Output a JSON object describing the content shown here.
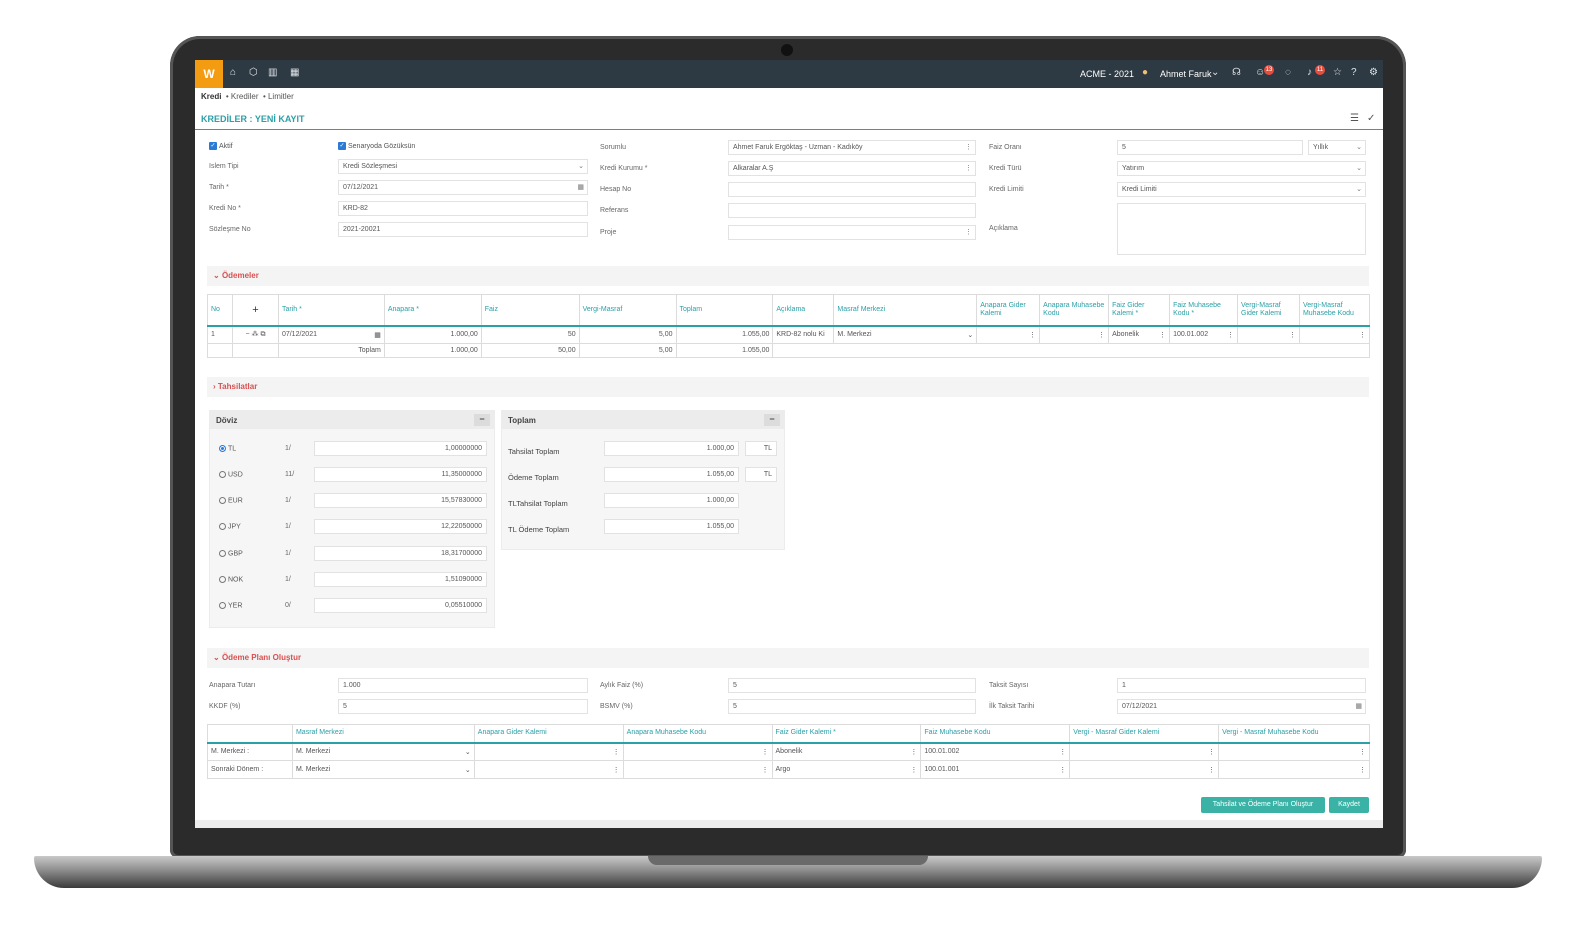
{
  "topbar": {
    "logo": "W",
    "company": "ACME - 2021",
    "user": "Ahmet Faruk",
    "badge_messages": "13",
    "badge_notifications": "11"
  },
  "breadcrumb": {
    "root": "Kredi",
    "items": [
      "• Krediler",
      "• Limitler"
    ]
  },
  "page_title": "KREDİLER : YENİ KAYIT",
  "form": {
    "aktif": "Aktif",
    "senaryo": "Senaryoda Gözüksün",
    "islem_tipi": {
      "label": "Islem Tipi",
      "value": "Kredi Sözleşmesi"
    },
    "tarih": {
      "label": "Tarih *",
      "value": "07/12/2021"
    },
    "kredi_no": {
      "label": "Kredi No *",
      "value": "KRD-82"
    },
    "sozlesme_no": {
      "label": "Sözleşme No",
      "value": "2021-20021"
    },
    "sorumlu": {
      "label": "Sorumlu",
      "value": "Ahmet Faruk Ergöktaş - Uzman - Kadıköy"
    },
    "kredi_kurumu": {
      "label": "Kredi Kurumu *",
      "value": "Alkaralar A.Ş"
    },
    "hesap_no": {
      "label": "Hesap No",
      "value": ""
    },
    "referans": {
      "label": "Referans",
      "value": ""
    },
    "proje": {
      "label": "Proje",
      "value": ""
    },
    "faiz_orani": {
      "label": "Faiz Oranı",
      "value": "5",
      "period": "Yıllık"
    },
    "kredi_turu": {
      "label": "Kredi Türü",
      "value": "Yatırım"
    },
    "kredi_limiti": {
      "label": "Kredi Limiti",
      "value": "Kredi Limiti"
    },
    "aciklama": {
      "label": "Açıklama",
      "value": ""
    }
  },
  "odemeler": {
    "title": "Ödemeler",
    "headers": [
      "No",
      "",
      "Tarih *",
      "Anapara *",
      "Faiz",
      "Vergi-Masraf",
      "Toplam",
      "Açıklama",
      "Masraf Merkezi",
      "Anapara Gider Kalemi",
      "Anapara Muhasebe Kodu",
      "Faiz Gider Kalemi *",
      "Faiz Muhasebe Kodu *",
      "Vergi-Masraf Gider Kalemi",
      "Vergi-Masraf Muhasebe Kodu"
    ],
    "row": {
      "no": "1",
      "tarih": "07/12/2021",
      "anapara": "1.000,00",
      "faiz": "50",
      "vergi": "5,00",
      "toplam": "1.055,00",
      "aciklama": "KRD-82 nolu Ki",
      "masraf_merkezi": "M. Merkezi",
      "anapara_gider": "",
      "anapara_muh": "",
      "faiz_gider": "Abonelik",
      "faiz_muh": "100.01.002",
      "vergi_gider": "",
      "vergi_muh": ""
    },
    "total": {
      "label": "Toplam",
      "anapara": "1.000,00",
      "faiz": "50,00",
      "vergi": "5,00",
      "toplam": "1.055,00"
    }
  },
  "tahsilatlar_title": "Tahsilatlar",
  "doviz": {
    "title": "Döviz",
    "rows": [
      {
        "code": "TL",
        "unit": "1/",
        "rate": "1,00000000",
        "selected": true
      },
      {
        "code": "USD",
        "unit": "11/",
        "rate": "11,35000000"
      },
      {
        "code": "EUR",
        "unit": "1/",
        "rate": "15,57830000"
      },
      {
        "code": "JPY",
        "unit": "1/",
        "rate": "12,22050000"
      },
      {
        "code": "GBP",
        "unit": "1/",
        "rate": "18,31700000"
      },
      {
        "code": "NOK",
        "unit": "1/",
        "rate": "1,51090000"
      },
      {
        "code": "YER",
        "unit": "0/",
        "rate": "0,05510000"
      }
    ]
  },
  "toplam": {
    "title": "Toplam",
    "rows": [
      {
        "label": "Tahsilat Toplam",
        "value": "1.000,00",
        "cur": "TL"
      },
      {
        "label": "Ödeme Toplam",
        "value": "1.055,00",
        "cur": "TL"
      },
      {
        "label": "TLTahsilat Toplam",
        "value": "1.000,00",
        "cur": ""
      },
      {
        "label": "TL Ödeme Toplam",
        "value": "1.055,00",
        "cur": ""
      }
    ]
  },
  "plan": {
    "title": "Ödeme Planı Oluştur",
    "anapara_tutari": {
      "label": "Anapara Tutarı",
      "value": "1.000"
    },
    "kkdf": {
      "label": "KKDF (%)",
      "value": "5"
    },
    "aylik_faiz": {
      "label": "Aylık Faiz (%)",
      "value": "5"
    },
    "bsmv": {
      "label": "BSMV (%)",
      "value": "5"
    },
    "taksit_sayisi": {
      "label": "Taksit Sayısı",
      "value": "1"
    },
    "ilk_taksit": {
      "label": "İlk Taksit Tarihi",
      "value": "07/12/2021"
    },
    "headers": [
      "",
      "Masraf Merkezi",
      "Anapara Gider Kalemi",
      "Anapara Muhasebe Kodu",
      "Faiz Gider Kalemi *",
      "Faiz Muhasebe Kodu",
      "Vergi - Masraf Gider Kalemi",
      "Vergi - Masraf Muhasebe Kodu"
    ],
    "rows": [
      {
        "label": "M. Merkezi :",
        "mm": "M. Merkezi",
        "faiz_gider": "Abonelik",
        "faiz_muh": "100.01.002"
      },
      {
        "label": "Sonraki Dönem :",
        "mm": "M. Merkezi",
        "faiz_gider": "Argo",
        "faiz_muh": "100.01.001"
      }
    ]
  },
  "buttons": {
    "create": "Tahsilat ve Ödeme Planı Oluştur",
    "save": "Kaydet"
  }
}
